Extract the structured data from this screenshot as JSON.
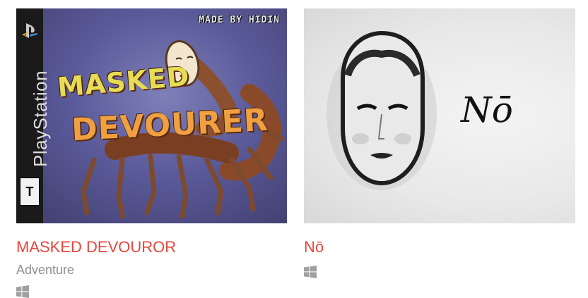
{
  "games": [
    {
      "title": "MASKED DEVOUROR",
      "genre": "Adventure",
      "platform_icon": "windows-icon",
      "cover": {
        "console_label": "PlayStation",
        "rating_letter": "T",
        "credit": "MADE BY HIDIN",
        "art_title_line1": "MASKED",
        "art_title_line2": "DEVOURER"
      }
    },
    {
      "title": "Nō",
      "genre": "",
      "platform_icon": "windows-icon",
      "cover": {
        "art_title": "Nō"
      }
    }
  ],
  "colors": {
    "title": "#e8453c",
    "genre": "#8f8f8f",
    "platform_icon": "#a0a0a0"
  }
}
